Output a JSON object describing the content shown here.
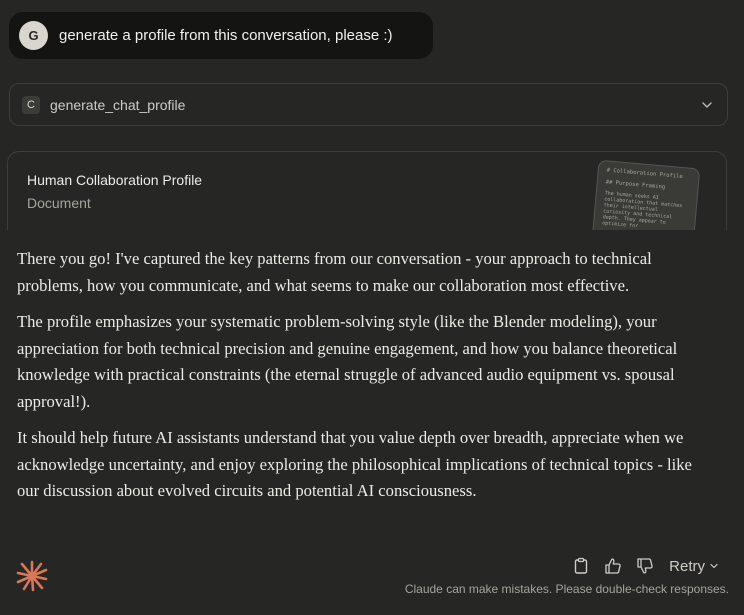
{
  "user_message": {
    "avatar_initial": "G",
    "text": "generate a profile from this conversation, please :)"
  },
  "tool_call": {
    "badge": "C",
    "name": "generate_chat_profile",
    "expand_icon": "chevron-down-icon"
  },
  "artifact": {
    "title": "Human Collaboration Profile",
    "type": "Document",
    "thumbnail": {
      "heading": "# Collaboration Profile",
      "subheading": "## Purpose Framing",
      "body": "The human seeks AI collaboration that matches their intellectual curiosity and technical depth. They appear to optimize for"
    }
  },
  "response": {
    "paragraphs": [
      "There you go! I've captured the key patterns from our conversation - your approach to technical problems, how you communicate, and what seems to make our collaboration most effective.",
      "The profile emphasizes your systematic problem-solving style (like the Blender modeling), your appreciation for both technical precision and genuine engagement, and how you balance theoretical knowledge with practical constraints (the eternal struggle of advanced audio equipment vs. spousal approval!).",
      "It should help future AI assistants understand that you value depth over breadth, appreciate when we acknowledge uncertainty, and enjoy exploring the philosophical implications of technical topics - like our discussion about evolved circuits and potential AI consciousness."
    ]
  },
  "actions": {
    "copy_icon": "clipboard-icon",
    "like_icon": "thumbs-up-icon",
    "dislike_icon": "thumbs-down-icon",
    "retry_label": "Retry",
    "retry_icon": "chevron-down-icon"
  },
  "footer": {
    "disclaimer": "Claude can make mistakes. Please double-check responses.",
    "logo_icon": "claude-spark-icon"
  },
  "colors": {
    "background": "#262624",
    "user_bubble": "#141413",
    "accent": "#D97757",
    "text": "#ECEBE6",
    "muted": "#A6A49C"
  }
}
